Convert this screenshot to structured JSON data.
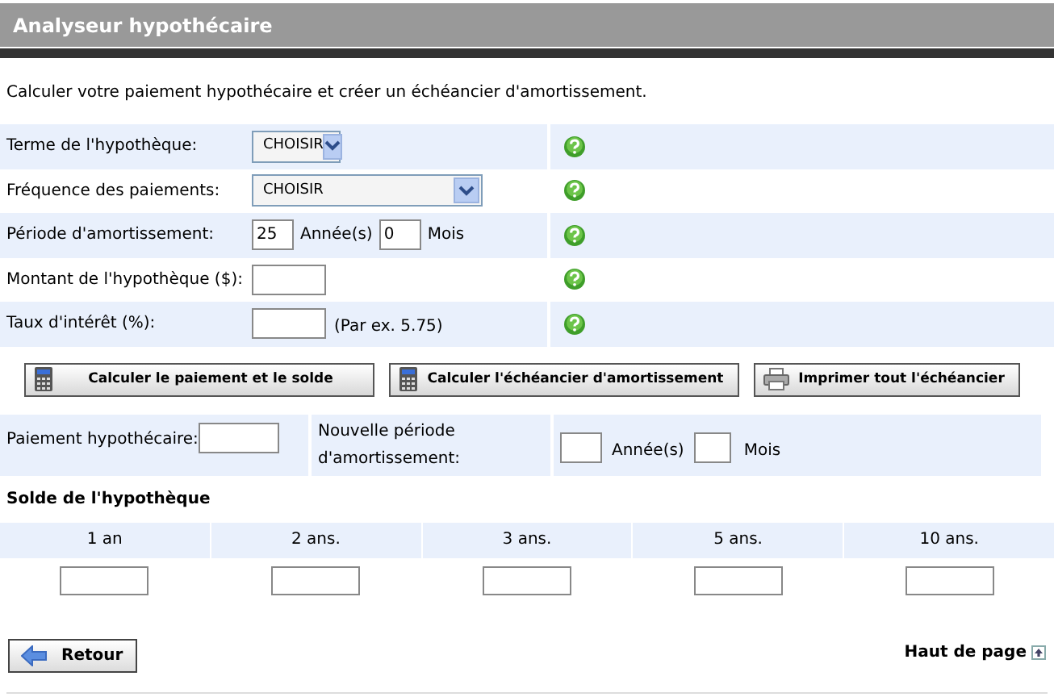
{
  "header": {
    "title": "Analyseur hypothécaire"
  },
  "intro": "Calculer votre paiement hypothécaire et créer un échéancier d'amortissement.",
  "form_rows": [
    {
      "kind": "short-select",
      "label": "Terme de l'hypothèque:",
      "value": "CHOISIR"
    },
    {
      "kind": "long-select",
      "label": "Fréquence des paiements:",
      "value": "CHOISIR"
    },
    {
      "kind": "period",
      "label": "Période d'amortissement:",
      "years": "25",
      "years_unit": "Année(s)",
      "months": "0",
      "months_unit": "Mois"
    },
    {
      "kind": "input",
      "label": "Montant de l'hypothèque ($):"
    },
    {
      "kind": "input",
      "label": "Taux d'intérêt (%):",
      "hint": "(Par ex. 5.75)"
    }
  ],
  "buttons": [
    {
      "kind": "calculator",
      "label": "Calculer le paiement et le solde"
    },
    {
      "kind": "calculator",
      "label": "Calculer l'échéancier d'amortissement"
    },
    {
      "kind": "printer",
      "label": "Imprimer tout l'échéancier"
    }
  ],
  "results": {
    "payment_label": "Paiement hypothécaire:",
    "new_period_label": "Nouvelle période d'amortissement:",
    "years_unit": "Année(s)",
    "months_unit": "Mois"
  },
  "balance": {
    "title": "Solde de l'hypothèque",
    "columns": [
      "1 an",
      "2 ans.",
      "3 ans.",
      "5 ans.",
      "10 ans."
    ]
  },
  "back_button": "Retour",
  "top_link": "Haut de page"
}
